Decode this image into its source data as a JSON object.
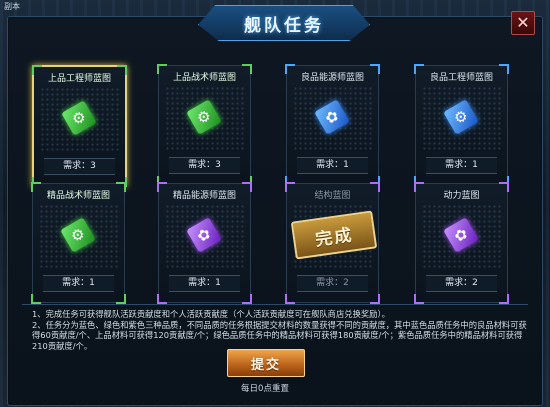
{
  "corner_label": "副本",
  "window": {
    "title": "舰队任务",
    "close_glyph": "✕"
  },
  "cards": [
    {
      "name": "上品工程师蓝图",
      "requirement": "需求：3",
      "color": "green",
      "icon_name": "gear-blueprint-icon",
      "icon_glyph": "⚙"
    },
    {
      "name": "上品战术师蓝图",
      "requirement": "需求：3",
      "color": "green",
      "icon_name": "gear-blueprint-icon",
      "icon_glyph": "⚙"
    },
    {
      "name": "良品能源师蓝图",
      "requirement": "需求：1",
      "color": "blue",
      "icon_name": "energy-blueprint-icon",
      "icon_glyph": "✿"
    },
    {
      "name": "良品工程师蓝图",
      "requirement": "需求：1",
      "color": "blue",
      "icon_name": "gear-blueprint-icon",
      "icon_glyph": "⚙"
    },
    {
      "name": "精品战术师蓝图",
      "requirement": "需求：1",
      "color": "green",
      "icon_name": "gear-blueprint-icon",
      "icon_glyph": "⚙"
    },
    {
      "name": "精品能源师蓝图",
      "requirement": "需求：1",
      "color": "purple",
      "icon_name": "energy-blueprint-icon",
      "icon_glyph": "✿"
    },
    {
      "name": "结构蓝图",
      "requirement": "需求：2",
      "color": "gray",
      "stamp": "完成"
    },
    {
      "name": "动力蓝图",
      "requirement": "需求：2",
      "color": "purple",
      "icon_name": "energy-blueprint-icon",
      "icon_glyph": "✿"
    }
  ],
  "info": {
    "line1": "1、完成任务可获得舰队活跃贡献度和个人活跃贡献度（个人活跃贡献度可在舰队商店兑换奖励）。",
    "line2": "2、任务分为蓝色、绿色和紫色三种品质，不同品质的任务根据提交材料的数量获得不同的贡献度，其中蓝色品质任务中的良品材料可获得60贡献度/个、上品材料可获得120贡献度/个；绿色品质任务中的精品材料可获得180贡献度/个；紫色品质任务中的精品材料可获得210贡献度/个。"
  },
  "submit_label": "提交",
  "reset_text": "每日0点重置"
}
